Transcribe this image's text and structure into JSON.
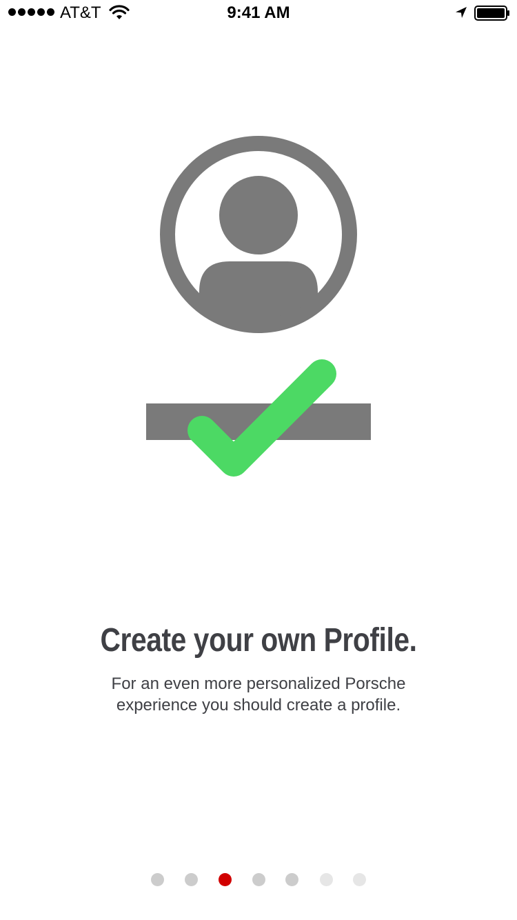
{
  "status_bar": {
    "carrier": "AT&T",
    "time": "9:41 AM",
    "signal_bars": 5,
    "icons": [
      "signal-icon",
      "wifi-icon",
      "location-arrow-icon",
      "battery-icon"
    ]
  },
  "illustration": {
    "icons": [
      "profile-avatar-icon",
      "checkmark-icon"
    ],
    "colors": {
      "gray": "#7a7a7a",
      "check_green": "#4cd964"
    }
  },
  "onboarding": {
    "title": "Create your own Profile.",
    "description": "For an even more personalized Porsche experience you should create a profile."
  },
  "pagination": {
    "page_count": 7,
    "current_page": 3,
    "colors": {
      "active": "#d10000",
      "inactive": "#cccccc",
      "inactive_light": "#e6e6e6"
    }
  }
}
